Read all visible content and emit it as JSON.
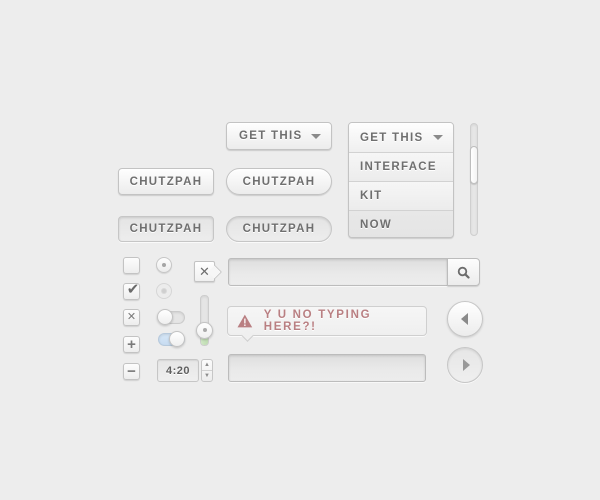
{
  "buttons": {
    "rect_default": "CHUTZPAH",
    "rect_pressed": "CHUTZPAH",
    "pill_default": "CHUTZPAH",
    "pill_pressed": "CHUTZPAH"
  },
  "dropdown_closed": {
    "label": "GET THIS",
    "icon": "caret-down-icon"
  },
  "dropdown_open": {
    "label": "GET THIS",
    "icon": "caret-down-icon",
    "items": [
      "INTERFACE",
      "KIT",
      "NOW"
    ]
  },
  "scrollbar": {
    "position": 0.3
  },
  "checkboxes": [
    {
      "state": "unchecked",
      "glyph": ""
    },
    {
      "state": "checked",
      "glyph": "✔"
    }
  ],
  "small_buttons": [
    {
      "name": "close",
      "glyph": "✕"
    },
    {
      "name": "add",
      "glyph": "+"
    },
    {
      "name": "remove",
      "glyph": "−"
    }
  ],
  "radios": [
    {
      "state": "enabled"
    },
    {
      "state": "disabled"
    }
  ],
  "toggles": [
    {
      "on": false
    },
    {
      "on": true
    }
  ],
  "stepper": {
    "value": "4:20",
    "up_glyph": "▲",
    "down_glyph": "▼"
  },
  "tag_close": {
    "glyph": "✕"
  },
  "vslider": {
    "value": 0.3
  },
  "search": {
    "value": "",
    "placeholder": "",
    "icon": "search-icon"
  },
  "alert": {
    "text": "Y U NO TYPING HERE?!",
    "icon": "warning-icon",
    "color": "#b97f82"
  },
  "text_input": {
    "value": "",
    "placeholder": ""
  },
  "nav": {
    "prev_icon": "arrow-left-icon",
    "next_icon": "arrow-right-icon"
  },
  "colors": {
    "background": "#ededed",
    "label": "#6f6f6f",
    "toggle_on": "#c7dcf1",
    "slider_fill": "#bedcb1"
  }
}
